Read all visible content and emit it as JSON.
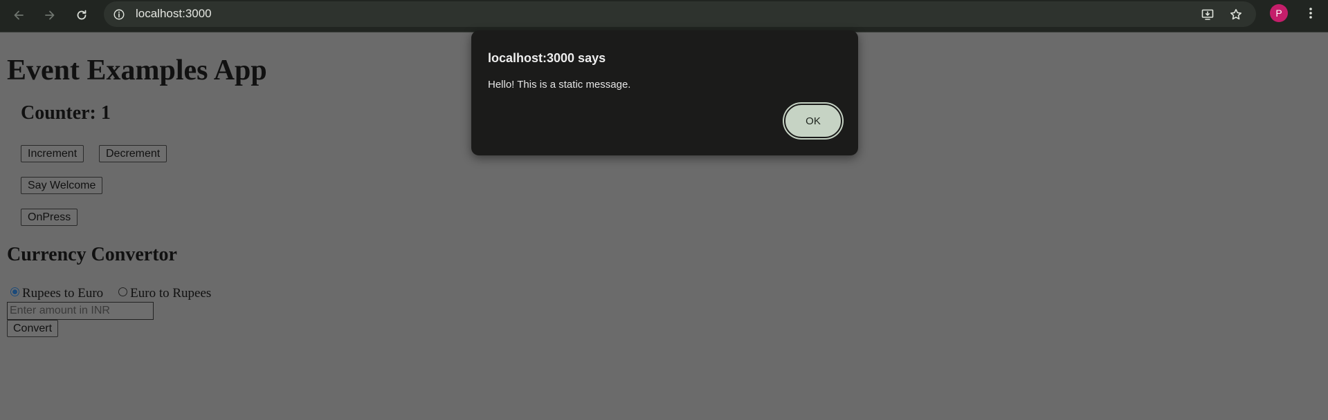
{
  "browser": {
    "url": "localhost:3000",
    "profile_initial": "P",
    "profile_color": "#c41e6a",
    "icons": [
      "back-icon",
      "forward-icon",
      "reload-icon",
      "site-info-icon",
      "install-app-icon",
      "bookmark-star-icon",
      "kebab-menu-icon"
    ]
  },
  "page": {
    "title": "Event Examples App",
    "counter_label": "Counter: 1",
    "buttons": {
      "increment": "Increment",
      "decrement": "Decrement",
      "say_welcome": "Say Welcome",
      "on_press": "OnPress"
    },
    "currency": {
      "title": "Currency Convertor",
      "options": [
        {
          "label": "Rupees to Euro",
          "checked": true
        },
        {
          "label": "Euro to Rupees",
          "checked": false
        }
      ],
      "amount_placeholder": "Enter amount in INR",
      "convert_label": "Convert"
    }
  },
  "alert": {
    "title": "localhost:3000 says",
    "message": "Hello! This is a static message.",
    "ok_label": "OK"
  }
}
